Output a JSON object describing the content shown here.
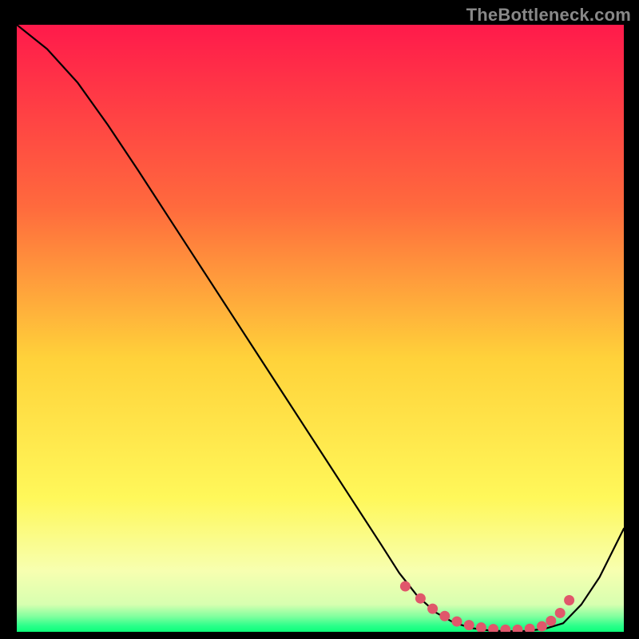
{
  "watermark": "TheBottleneck.com",
  "chart_data": {
    "type": "line",
    "title": "",
    "xlabel": "",
    "ylabel": "",
    "xlim": [
      0,
      100
    ],
    "ylim": [
      0,
      100
    ],
    "grid": false,
    "legend": false,
    "gradient_stops": [
      {
        "offset": 0.0,
        "color": "#ff1a4b"
      },
      {
        "offset": 0.3,
        "color": "#ff6a3d"
      },
      {
        "offset": 0.55,
        "color": "#ffd23a"
      },
      {
        "offset": 0.78,
        "color": "#fff85a"
      },
      {
        "offset": 0.9,
        "color": "#f7ffb0"
      },
      {
        "offset": 0.955,
        "color": "#d7ffb0"
      },
      {
        "offset": 0.975,
        "color": "#7fff9e"
      },
      {
        "offset": 0.99,
        "color": "#2bff8a"
      },
      {
        "offset": 1.0,
        "color": "#0cff7a"
      }
    ],
    "series": [
      {
        "name": "bottleneck-curve",
        "x": [
          0,
          5,
          10,
          15,
          20,
          25,
          30,
          35,
          40,
          45,
          50,
          55,
          60,
          63,
          66,
          69,
          72,
          75,
          78,
          81,
          84,
          87,
          90,
          93,
          96,
          100
        ],
        "y": [
          100,
          96,
          90.5,
          83.5,
          76,
          68.3,
          60.6,
          52.9,
          45.2,
          37.5,
          29.8,
          22.1,
          14.4,
          9.7,
          5.9,
          3.2,
          1.5,
          0.6,
          0.2,
          0.1,
          0.15,
          0.5,
          1.4,
          4.5,
          9,
          17
        ]
      }
    ],
    "markers": {
      "name": "optimal-range-dots",
      "color": "#e0576b",
      "radius": 6.5,
      "x": [
        64,
        66.5,
        68.5,
        70.5,
        72.5,
        74.5,
        76.5,
        78.5,
        80.5,
        82.5,
        84.5,
        86.5,
        88,
        89.5,
        91
      ],
      "y": [
        7.5,
        5.5,
        3.8,
        2.6,
        1.7,
        1.1,
        0.7,
        0.45,
        0.35,
        0.35,
        0.5,
        0.9,
        1.8,
        3.1,
        5.2
      ]
    }
  }
}
